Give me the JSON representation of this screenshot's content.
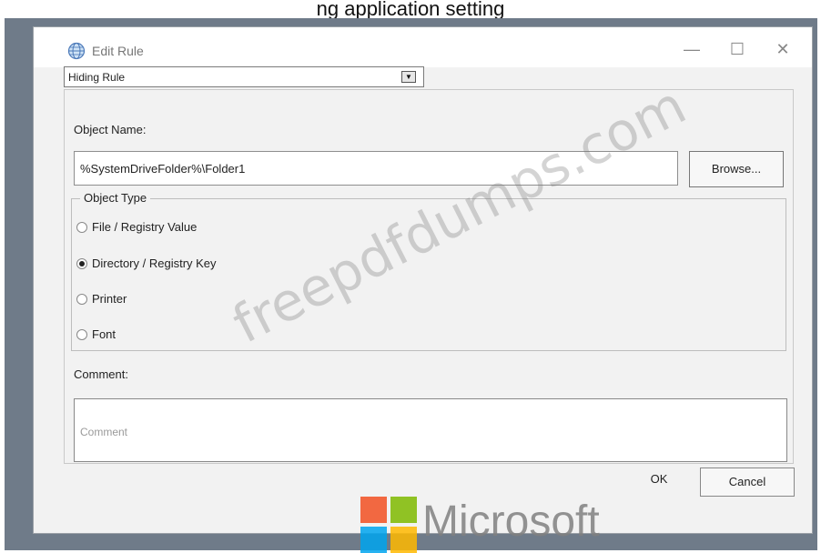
{
  "caption": "ng application setting",
  "dialog": {
    "title": "Edit Rule",
    "rule_type": "Hiding Rule",
    "object_name_label": "Object Name:",
    "object_name_value": "%SystemDriveFolder%\\Folder1",
    "browse_label": "Browse...",
    "object_type_label": "Object Type",
    "object_types": [
      {
        "label": "File / Registry Value",
        "checked": false
      },
      {
        "label": "Directory / Registry Key",
        "checked": true
      },
      {
        "label": "Printer",
        "checked": false
      },
      {
        "label": "Font",
        "checked": false
      }
    ],
    "comment_label": "Comment:",
    "comment_placeholder": "Comment",
    "ok_label": "OK",
    "cancel_label": "Cancel"
  },
  "watermark": "freepdfdumps.com",
  "brand": {
    "name": "Microsoft",
    "colors": {
      "red": "#f25022",
      "green": "#7fba00",
      "blue": "#00a4ef",
      "yellow": "#ffb900"
    }
  }
}
